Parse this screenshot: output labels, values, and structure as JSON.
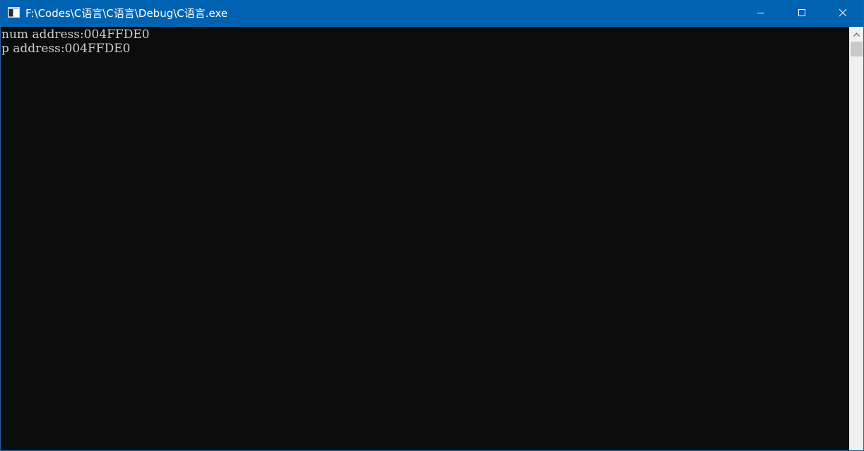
{
  "window": {
    "title": "F:\\Codes\\C语言\\C语言\\Debug\\C语言.exe",
    "icon": "console-app-icon",
    "controls": {
      "minimize": "minimize-icon",
      "maximize": "maximize-icon",
      "close": "close-icon"
    }
  },
  "console": {
    "lines": [
      "num address:004FFDE0",
      "p address:004FFDE0"
    ]
  },
  "colors": {
    "titlebar": "#0063b1",
    "console_bg": "#0c0c0c",
    "console_text": "#cccccc",
    "scrollbar_track": "#f0f0f0",
    "scrollbar_thumb": "#c9c9c9"
  }
}
